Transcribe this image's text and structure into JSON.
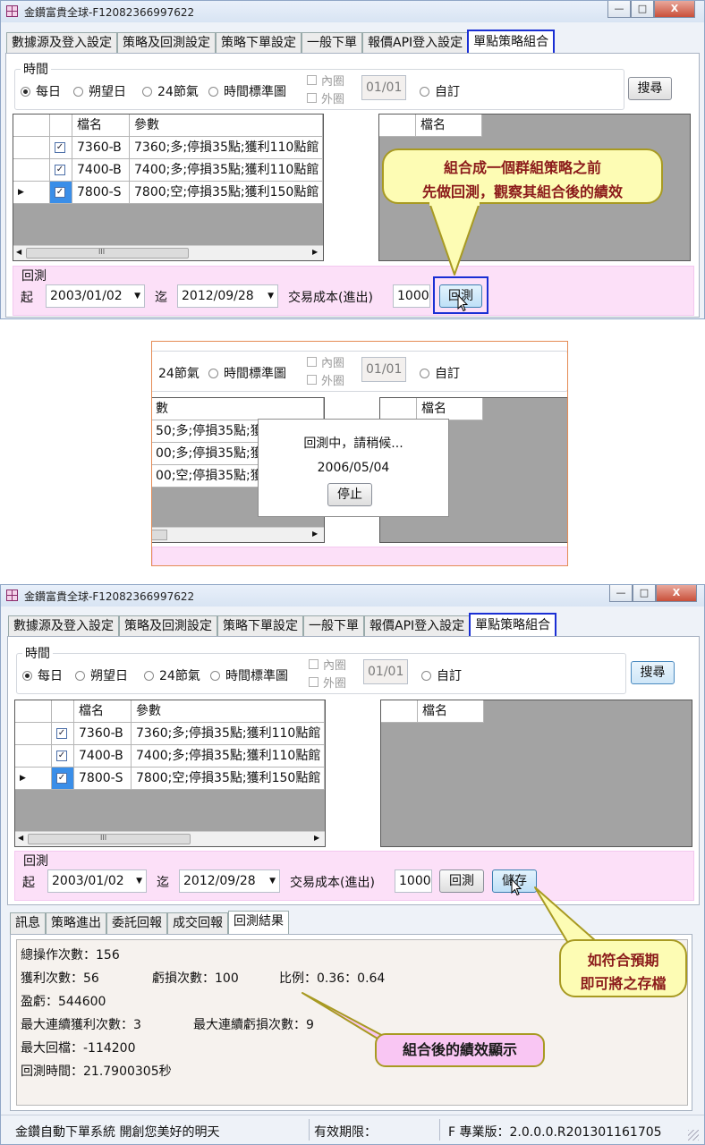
{
  "window": {
    "title": "金鑽富貴全球-F12082366997622",
    "minimize_glyph": "—",
    "maximize_glyph": "□",
    "close_glyph": "X"
  },
  "tabs": [
    "數據源及登入設定",
    "策略及回測設定",
    "策略下單設定",
    "一般下單",
    "報價API登入設定",
    "單點策略組合"
  ],
  "time_group": {
    "label": "時間",
    "options": [
      "每日",
      "朔望日",
      "24節氣",
      "時間標準圖"
    ],
    "selected": "每日",
    "inner_circle": "內圈",
    "outer_circle": "外圈",
    "date_value": "01/01",
    "custom": "自訂",
    "search_button": "搜尋"
  },
  "grid_left": {
    "headers": [
      "檔名",
      "參數"
    ],
    "rows": [
      {
        "name": "7360-B",
        "params": "7360;多;停損35點;獲利110點館",
        "checked": true
      },
      {
        "name": "7400-B",
        "params": "7400;多;停損35點;獲利110點館",
        "checked": true
      },
      {
        "name": "7800-S",
        "params": "7800;空;停損35點;獲利150點館",
        "checked": true
      }
    ],
    "current_row_marker": "▶",
    "scroll_left": "◀",
    "scroll_right": "▶",
    "scroll_grip": "III"
  },
  "grid_right": {
    "headers": [
      "檔名"
    ]
  },
  "backtest": {
    "label": "回測",
    "start_label": "起",
    "start_date": "2003/01/02",
    "to_label": "迄",
    "end_date": "2012/09/28",
    "cost_label": "交易成本(進出)",
    "cost_value": "1000",
    "run_button": "回測",
    "save_button": "儲存"
  },
  "callout1": {
    "line1": "組合成一個群組策略之前",
    "line2": "先做回測，觀察其組合後的績效"
  },
  "progress_dialog": {
    "message": "回測中，請稍候...",
    "date": "2006/05/04",
    "stop_button": "停止",
    "partial_radio": "24節氣",
    "partial_params": [
      "50;多;停損35點;獲",
      "00;多;停損35點;獲",
      "00;空;停損35點;獲"
    ]
  },
  "bottom_tabs": [
    "訊息",
    "策略進出",
    "委託回報",
    "成交回報",
    "回測結果"
  ],
  "results": {
    "total_trades": "總操作次數：156",
    "wins": "獲利次數：56",
    "losses": "虧損次數：100",
    "ratio": "比例：0.36：0.64",
    "pnl": "盈虧：544600",
    "max_win_streak": "最大連續獲利次數：3",
    "max_loss_streak": "最大連續虧損次數：9",
    "max_drawdown": "最大回檔：-114200",
    "duration": "回測時間：21.7900305秒"
  },
  "callout2": {
    "line1": "如符合預期",
    "line2": "即可將之存檔"
  },
  "callout3": {
    "text": "組合後的績效顯示"
  },
  "status_bar": {
    "system": "金鑽自動下單系統  開創您美好的明天",
    "expiry": "有效期限：",
    "version": "F 專業版：2.0.0.0.R201301161705"
  },
  "colors": {
    "highlight": "#1a2fd4",
    "callout_yellow": "#fdfcb4",
    "callout_pink": "#f9c6f3",
    "callout_text": "#8b1a1a",
    "backtest_band": "#fce0f8"
  }
}
